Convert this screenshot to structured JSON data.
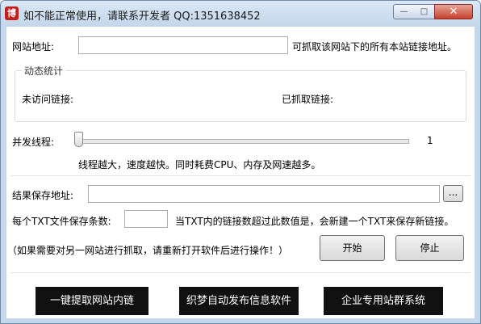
{
  "window": {
    "title": "如不能正常使用，请联系开发者 QQ:1351638452",
    "app_icon_glyph": "博",
    "minimize_glyph": "—",
    "maximize_glyph": "□",
    "close_glyph": "✕"
  },
  "url_row": {
    "label": "网站地址:",
    "value": "",
    "hint": "可抓取该网站下的所有本站链接地址。"
  },
  "stats": {
    "title": "动态统计",
    "unvisited_label": "未访问链接:",
    "captured_label": "已抓取链接:"
  },
  "threads": {
    "label": "并发线程:",
    "value": "1",
    "note": "线程越大，速度越快。同时耗费CPU、内存及网速越多。"
  },
  "save": {
    "label": "结果保存地址:",
    "value": "",
    "browse_label": "..."
  },
  "per_file": {
    "label": "每个TXT文件保存条数:",
    "value": "",
    "note": "当TXT内的链接数超过此数值是，会新建一个TXT来保存新链接。"
  },
  "notice": "（如果需要对另一网站进行抓取，请重新打开软件后进行操作！）",
  "buttons": {
    "start": "开始",
    "stop": "停止"
  },
  "promos": [
    "一键提取网站内链",
    "织梦自动发布信息软件",
    "企业专用站群系统"
  ]
}
